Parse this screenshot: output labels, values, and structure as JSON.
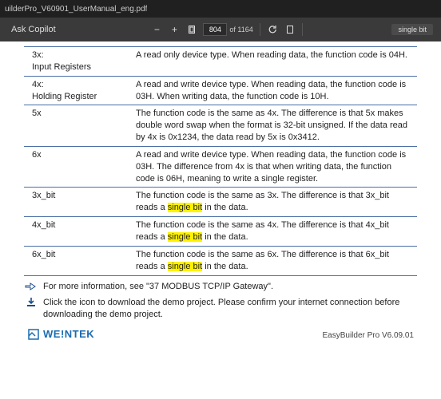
{
  "titlebar": {
    "filename": "uilderPro_V60901_UserManual_eng.pdf"
  },
  "toolbar": {
    "ask": "Ask Copilot",
    "page_current": "804",
    "page_total": "of 1164",
    "search_term": "single bit"
  },
  "table": {
    "rows": [
      {
        "t": "3x:\nInput Registers",
        "d": "A read only device type. When reading data, the function code is 04H."
      },
      {
        "t": "4x:\nHolding Register",
        "d": "A read and write device type. When reading data, the function code is 03H. When writing data, the function code is 10H."
      },
      {
        "t": "5x",
        "d": "The function code is the same as 4x. The difference is that 5x makes double word swap when the format is 32-bit unsigned. If the data read by 4x is 0x1234, the data read by 5x is 0x3412."
      },
      {
        "t": "6x",
        "d": "A read and write device type. When reading data, the function code is 03H. The difference from 4x is that when writing data, the function code is 06H, meaning to write a single register."
      },
      {
        "t": "3x_bit",
        "d": "The function code is the same as 3x. The difference is that 3x_bit reads a |single bit| in the data."
      },
      {
        "t": "4x_bit",
        "d": "The function code is the same as 4x. The difference is that 4x_bit reads a |single bit| in the data."
      },
      {
        "t": "6x_bit",
        "d": "The function code is the same as 6x. The difference is that 6x_bit reads a |single bit| in the data."
      }
    ]
  },
  "note1": "For more information, see \"37 MODBUS TCP/IP Gateway\".",
  "note2": "Click the icon to download the demo project. Please confirm your internet connection before downloading the demo project.",
  "footer": {
    "brand": "WE!NTEK",
    "version": "EasyBuilder  Pro  V6.09.01"
  }
}
